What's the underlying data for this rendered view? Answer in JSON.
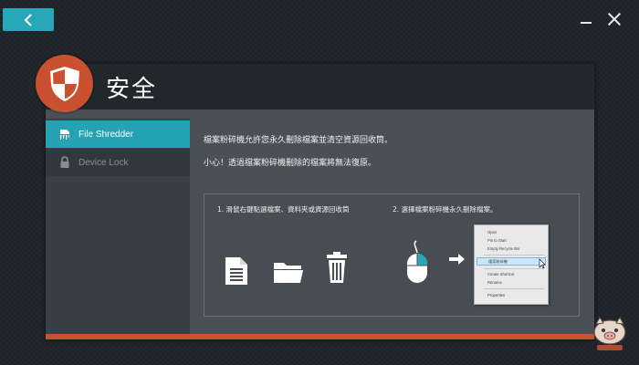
{
  "header": {
    "title": "安全"
  },
  "sidebar": {
    "items": [
      {
        "label": "File Shredder",
        "icon": "shredder-icon",
        "active": true
      },
      {
        "label": "Device Lock",
        "icon": "lock-icon",
        "active": false
      }
    ]
  },
  "main": {
    "description_1": "檔案粉碎機允許您永久刪除檔案並清空資源回收筒。",
    "description_2": "小心！透過檔案粉碎機刪除的檔案將無法復原。",
    "step1": "1. 滑鼠右鍵點選檔案、資料夾或資源回收筒",
    "step2": "2. 選擇檔案粉碎機永久刪除檔案。",
    "context_menu": [
      "Open",
      "Pin to Start",
      "Empty Recycle Bin",
      "檔案粉碎機",
      "Create Shortcut",
      "Rename",
      "Properties"
    ]
  },
  "colors": {
    "accent": "#27a7b8",
    "brand": "#c9512f",
    "panel": "#4b5056",
    "sidebar": "#3a3f45"
  }
}
